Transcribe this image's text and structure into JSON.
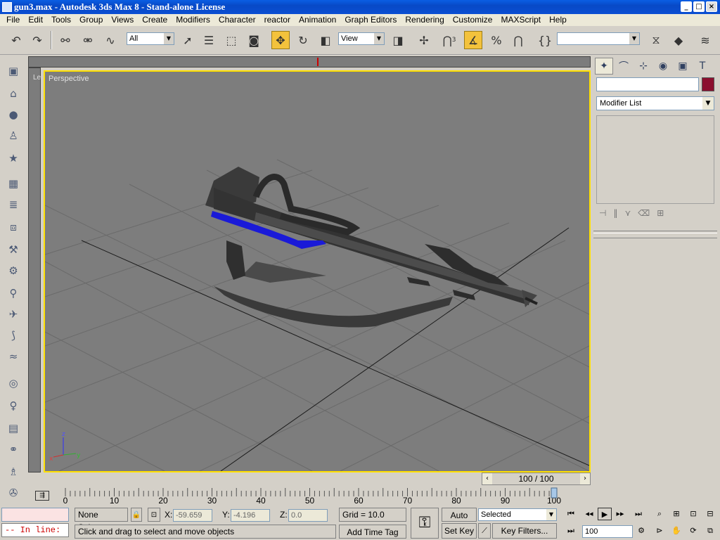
{
  "window": {
    "title": "gun3.max - Autodesk 3ds Max 8 - Stand-alone License",
    "buttons": [
      "_",
      "□",
      "×"
    ]
  },
  "menubar": {
    "items": [
      "File",
      "Edit",
      "Tools",
      "Group",
      "Views",
      "Create",
      "Modifiers",
      "Character",
      "reactor",
      "Animation",
      "Graph Editors",
      "Rendering",
      "Customize",
      "MAXScript",
      "Help"
    ]
  },
  "toolbar": {
    "selection_filter": "All",
    "reference_coord": "View",
    "named_selection": "",
    "snap_labels": {
      "snap": "3",
      "percent": "%"
    }
  },
  "viewport": {
    "label": "Perspective",
    "side_label": "Le",
    "axis_labels": {
      "x": "x",
      "y": "y",
      "z": "z"
    }
  },
  "command_panel": {
    "object_name": "",
    "object_color": "#8b0f2e",
    "modifier_list": "Modifier List"
  },
  "time_slider": {
    "label": "100 / 100",
    "current_frame": 100,
    "total_frames": 100
  },
  "trackbar": {
    "ticks": [
      "0",
      "10",
      "20",
      "30",
      "40",
      "50",
      "60",
      "70",
      "80",
      "90",
      "100"
    ]
  },
  "status": {
    "maxscript_prompt": "-- In line:",
    "selection": "None Selecte",
    "x_label": "X:",
    "x_value": "-59.659",
    "y_label": "Y:",
    "y_value": "-4.196",
    "z_label": "Z:",
    "z_value": "0.0",
    "grid": "Grid = 10.0",
    "prompt": "Click and drag to select and move objects",
    "add_time_tag": "Add Time Tag",
    "auto_key": "Auto Key",
    "set_key": "Set Key",
    "key_mode": "Selected",
    "key_filters": "Key Filters...",
    "frame_field": "100"
  }
}
